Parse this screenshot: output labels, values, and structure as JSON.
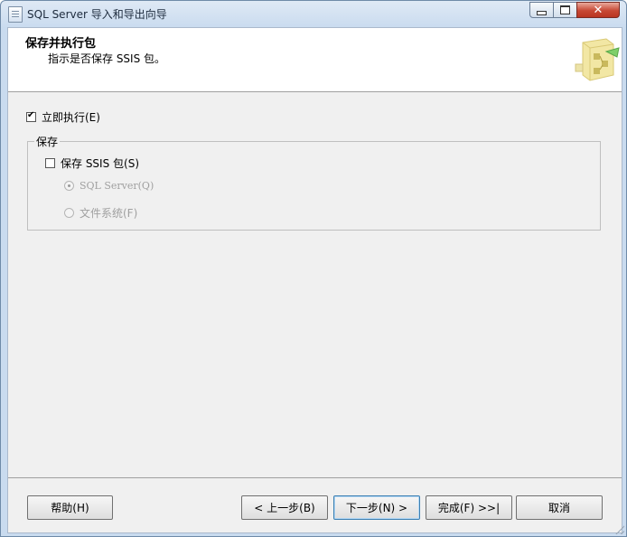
{
  "window": {
    "title": "SQL Server 导入和导出向导",
    "close_glyph": "✕"
  },
  "header": {
    "title": "保存并执行包",
    "subtitle": "指示是否保存 SSIS 包。"
  },
  "options": {
    "run_immediately": {
      "label": "立即执行(E)",
      "checked": true
    }
  },
  "save_group": {
    "legend": "保存",
    "save_package": {
      "label": "保存 SSIS 包(S)",
      "checked": false
    },
    "sql_server": {
      "label": "SQL Server(Q)",
      "selected": true,
      "enabled": false
    },
    "file_system": {
      "label": "文件系统(F)",
      "selected": false,
      "enabled": false
    }
  },
  "buttons": {
    "help": "帮助(H)",
    "back": "< 上一步(B)",
    "next": "下一步(N) >",
    "finish": "完成(F) >>|",
    "cancel": "取消"
  },
  "colors": {
    "title_bar": "#c9dbef",
    "client_bg": "#f0f0f0",
    "close_button": "#c74834"
  }
}
